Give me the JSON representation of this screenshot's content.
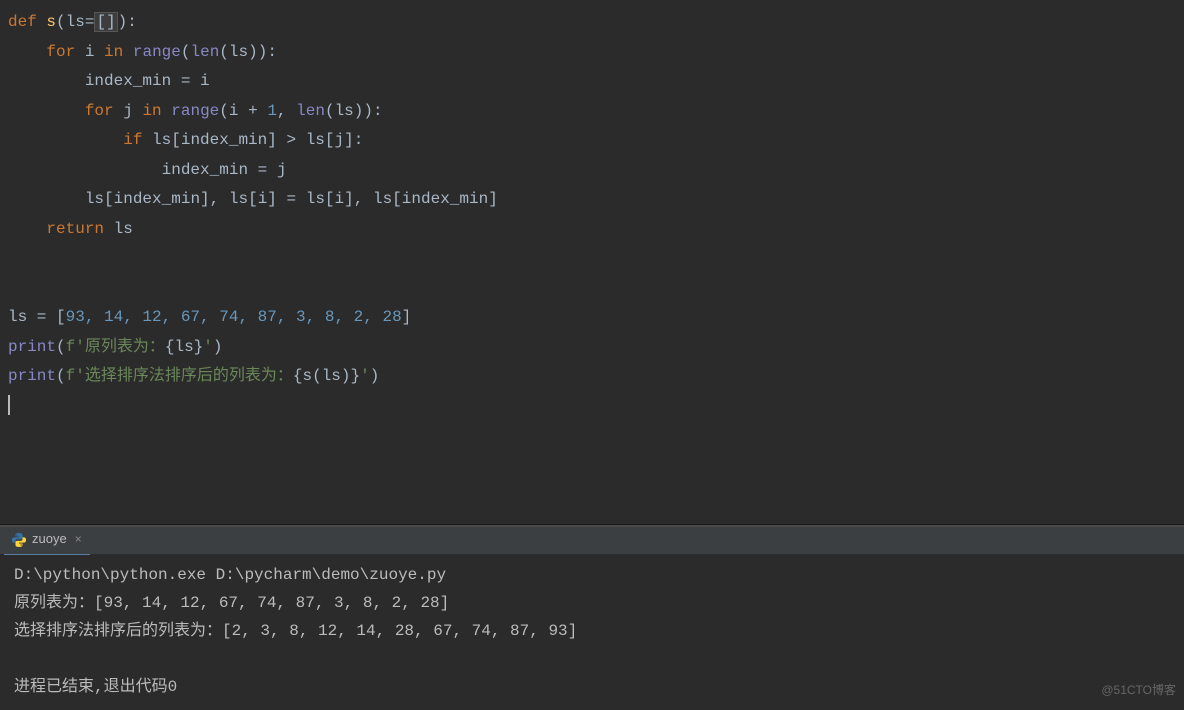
{
  "code": {
    "kw_def": "def",
    "fn_name": "s",
    "open_paren": "(",
    "param_ls": "ls",
    "eq": "=",
    "lsq": "[",
    "rsq": "]",
    "close_paren": ")",
    "colon": ":",
    "kw_for": "for",
    "i": "i",
    "j": "j",
    "kw_in": "in",
    "range": "range",
    "len": "len",
    "index_min": "index_min",
    "assign": " = ",
    "plus": " + ",
    "one": "1",
    "comma": ",",
    "kw_if": "if",
    "gt": " > ",
    "kw_return": "return",
    "ls": "ls",
    "ls_assign_list": "ls = [",
    "list_vals": "93, 14, 12, 67, 74, 87, 3, 8, 2, 28",
    "rbr": "]",
    "print": "print",
    "fprefix": "f",
    "sq": "'",
    "str1": "原列表为：",
    "brace_l": "{",
    "brace_r": "}",
    "str2": "选择排序法排序后的列表为："
  },
  "run_tab": {
    "label": "zuoye"
  },
  "console": {
    "line1": "D:\\python\\python.exe D:\\pycharm\\demo\\zuoye.py",
    "line2": "原列表为：[93, 14, 12, 67, 74, 87, 3, 8, 2, 28]",
    "line3": "选择排序法排序后的列表为：[2, 3, 8, 12, 14, 28, 67, 74, 87, 93]",
    "line4": "",
    "line5": "进程已结束,退出代码0"
  },
  "watermark": "@51CTO博客"
}
